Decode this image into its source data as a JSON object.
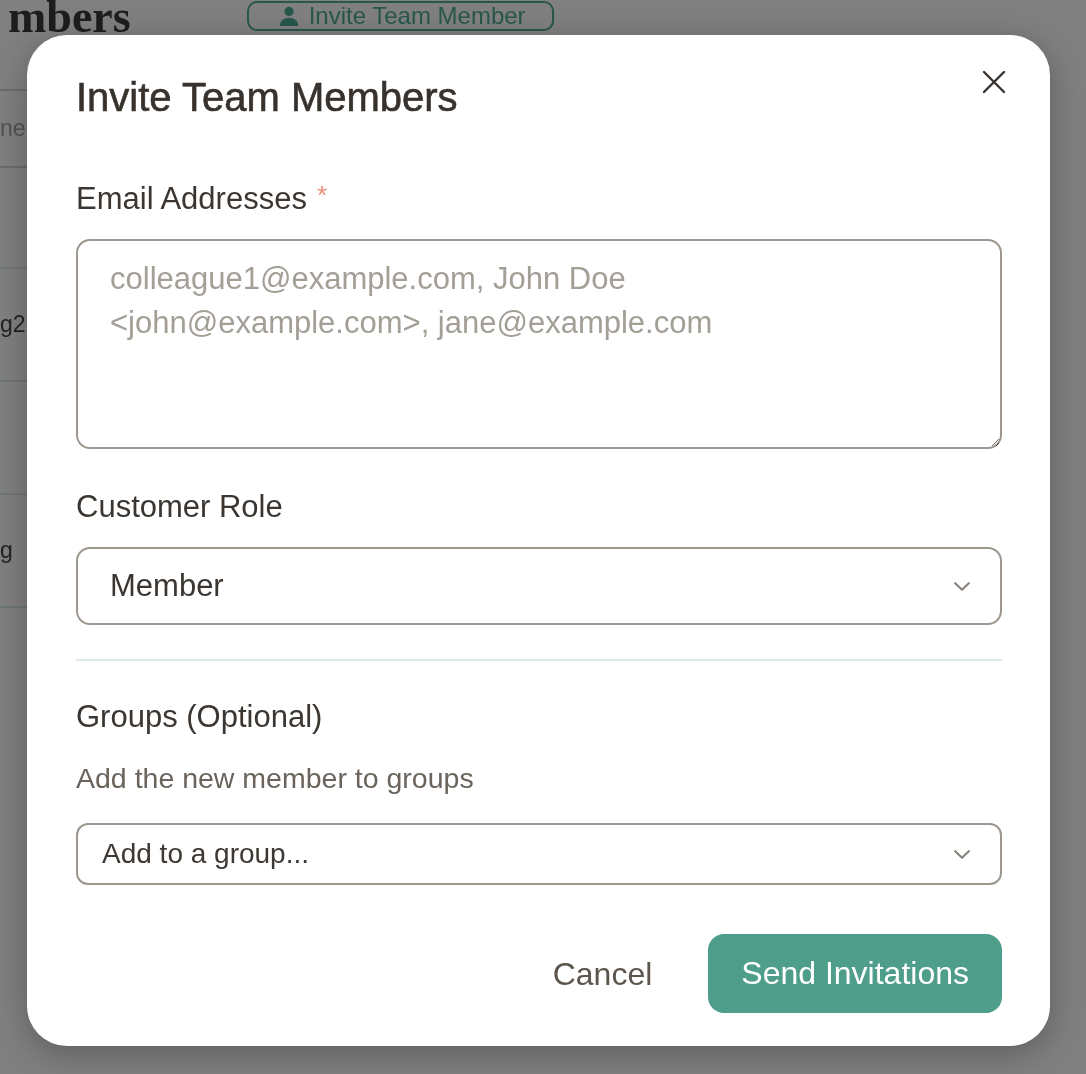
{
  "page": {
    "title": "mbers",
    "invite_button": {
      "label": "Invite Team Member"
    },
    "search": {
      "placeholder": "ne"
    },
    "rows": [
      {
        "cell": "g2"
      },
      {},
      {
        "cell": "g"
      }
    ]
  },
  "dialog": {
    "title": "Invite Team Members",
    "fields": [
      {
        "kind": "textarea",
        "label": "Email Addresses",
        "required_mark": "*",
        "placeholder": "colleague1@example.com, John Doe <john@example.com>, jane@example.com"
      },
      {
        "kind": "select",
        "label": "Customer Role",
        "value": "Member"
      },
      {
        "kind": "divider"
      },
      {
        "kind": "combobox",
        "label": "Groups (Optional)",
        "description": "Add the new member to groups",
        "placeholder": "Add to a group..."
      }
    ],
    "buttons": [
      {
        "kind": "secondary",
        "label": "Cancel"
      },
      {
        "kind": "primary",
        "label": "Send Invitations"
      }
    ]
  }
}
